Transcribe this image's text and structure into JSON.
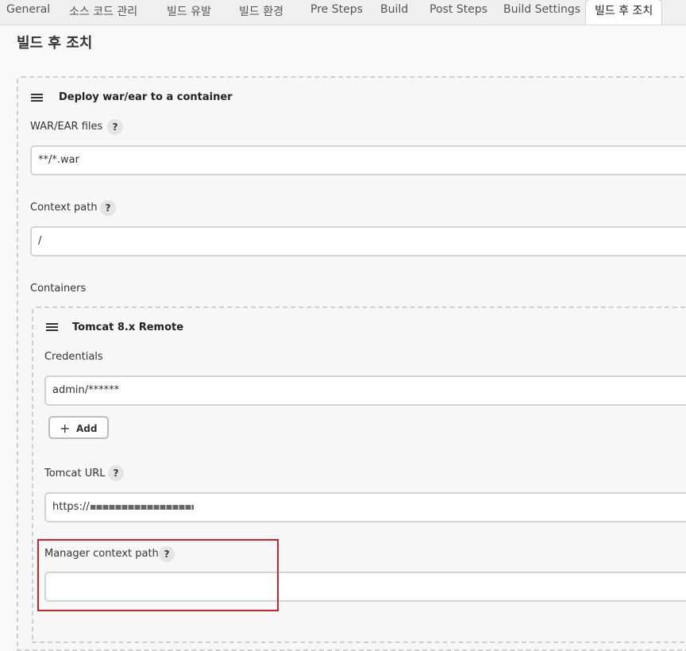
{
  "tabs": [
    {
      "label": "General"
    },
    {
      "label": "소스 코드 관리"
    },
    {
      "label": "빌드 유발"
    },
    {
      "label": "빌드 환경"
    },
    {
      "label": "Pre Steps"
    },
    {
      "label": "Build"
    },
    {
      "label": "Post Steps"
    },
    {
      "label": "Build Settings"
    },
    {
      "label": "빌드 후 조치",
      "active": true
    }
  ],
  "section": {
    "title": "빌드 후 조치"
  },
  "deploy": {
    "title": "Deploy war/ear to a container",
    "war_label": "WAR/EAR files",
    "war_value": "**/*.war",
    "context_label": "Context path",
    "context_value": "/",
    "containers_label": "Containers"
  },
  "tomcat": {
    "title": "Tomcat 8.x Remote",
    "credentials_label": "Credentials",
    "credentials_value": "admin/******",
    "add_label": "Add",
    "url_label": "Tomcat URL",
    "url_value": "https://",
    "manager_label": "Manager context path",
    "manager_value": ""
  },
  "help_glyph": "?",
  "colors": {
    "highlight": "#d0212a",
    "accent": "#333333"
  }
}
